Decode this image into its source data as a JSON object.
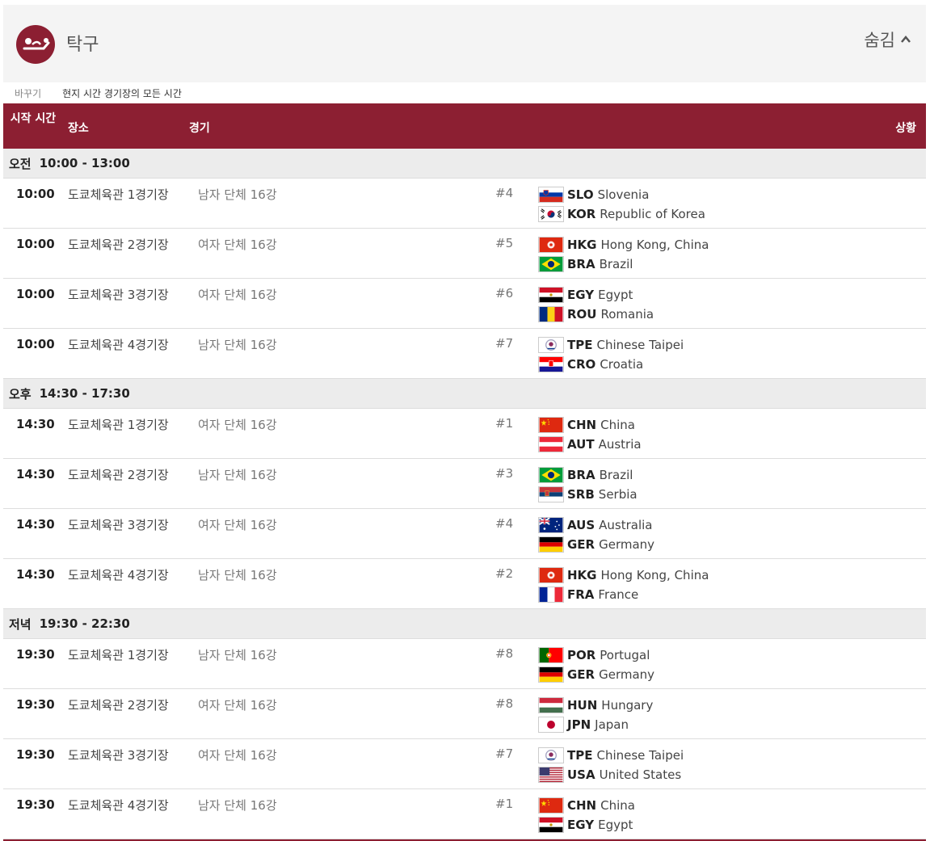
{
  "sport": {
    "icon": "table-tennis-icon",
    "title": "탁구",
    "hide_label": "숨김"
  },
  "time_bar": {
    "switch_label": "바꾸기",
    "timezone_label": "현지 시간 경기장의 모든 시간"
  },
  "table_header": {
    "time": "시작 시간",
    "venue": "장소",
    "event": "경기",
    "status": "상황"
  },
  "colors": {
    "accent": "#8c1f32",
    "session_bg": "#ececec"
  },
  "sessions": [
    {
      "label": "오전",
      "range": "10:00 - 13:00",
      "matches": [
        {
          "time": "10:00",
          "venue": "도쿄체육관 1경기장",
          "event": "남자 단체 16강",
          "match_no": "#4",
          "team1": {
            "code": "SLO",
            "name": "Slovenia",
            "flag": "slo"
          },
          "team2": {
            "code": "KOR",
            "name": "Republic of Korea",
            "flag": "kor"
          }
        },
        {
          "time": "10:00",
          "venue": "도쿄체육관 2경기장",
          "event": "여자 단체 16강",
          "match_no": "#5",
          "team1": {
            "code": "HKG",
            "name": "Hong Kong, China",
            "flag": "hkg"
          },
          "team2": {
            "code": "BRA",
            "name": "Brazil",
            "flag": "bra"
          }
        },
        {
          "time": "10:00",
          "venue": "도쿄체육관 3경기장",
          "event": "여자 단체 16강",
          "match_no": "#6",
          "team1": {
            "code": "EGY",
            "name": "Egypt",
            "flag": "egy"
          },
          "team2": {
            "code": "ROU",
            "name": "Romania",
            "flag": "rou"
          }
        },
        {
          "time": "10:00",
          "venue": "도쿄체육관 4경기장",
          "event": "남자 단체 16강",
          "match_no": "#7",
          "team1": {
            "code": "TPE",
            "name": "Chinese Taipei",
            "flag": "tpe"
          },
          "team2": {
            "code": "CRO",
            "name": "Croatia",
            "flag": "cro"
          }
        }
      ]
    },
    {
      "label": "오후",
      "range": "14:30 - 17:30",
      "matches": [
        {
          "time": "14:30",
          "venue": "도쿄체육관 1경기장",
          "event": "여자 단체 16강",
          "match_no": "#1",
          "team1": {
            "code": "CHN",
            "name": "China",
            "flag": "chn"
          },
          "team2": {
            "code": "AUT",
            "name": "Austria",
            "flag": "aut"
          }
        },
        {
          "time": "14:30",
          "venue": "도쿄체육관 2경기장",
          "event": "남자 단체 16강",
          "match_no": "#3",
          "team1": {
            "code": "BRA",
            "name": "Brazil",
            "flag": "bra"
          },
          "team2": {
            "code": "SRB",
            "name": "Serbia",
            "flag": "srb"
          }
        },
        {
          "time": "14:30",
          "venue": "도쿄체육관 3경기장",
          "event": "여자 단체 16강",
          "match_no": "#4",
          "team1": {
            "code": "AUS",
            "name": "Australia",
            "flag": "aus"
          },
          "team2": {
            "code": "GER",
            "name": "Germany",
            "flag": "ger"
          }
        },
        {
          "time": "14:30",
          "venue": "도쿄체육관 4경기장",
          "event": "남자 단체 16강",
          "match_no": "#2",
          "team1": {
            "code": "HKG",
            "name": "Hong Kong, China",
            "flag": "hkg"
          },
          "team2": {
            "code": "FRA",
            "name": "France",
            "flag": "fra"
          }
        }
      ]
    },
    {
      "label": "저녁",
      "range": "19:30 - 22:30",
      "matches": [
        {
          "time": "19:30",
          "venue": "도쿄체육관 1경기장",
          "event": "남자 단체 16강",
          "match_no": "#8",
          "team1": {
            "code": "POR",
            "name": "Portugal",
            "flag": "por"
          },
          "team2": {
            "code": "GER",
            "name": "Germany",
            "flag": "ger"
          }
        },
        {
          "time": "19:30",
          "venue": "도쿄체육관 2경기장",
          "event": "여자 단체 16강",
          "match_no": "#8",
          "team1": {
            "code": "HUN",
            "name": "Hungary",
            "flag": "hun"
          },
          "team2": {
            "code": "JPN",
            "name": "Japan",
            "flag": "jpn"
          }
        },
        {
          "time": "19:30",
          "venue": "도쿄체육관 3경기장",
          "event": "여자 단체 16강",
          "match_no": "#7",
          "team1": {
            "code": "TPE",
            "name": "Chinese Taipei",
            "flag": "tpe"
          },
          "team2": {
            "code": "USA",
            "name": "United States",
            "flag": "usa"
          }
        },
        {
          "time": "19:30",
          "venue": "도쿄체육관 4경기장",
          "event": "남자 단체 16강",
          "match_no": "#1",
          "team1": {
            "code": "CHN",
            "name": "China",
            "flag": "chn"
          },
          "team2": {
            "code": "EGY",
            "name": "Egypt",
            "flag": "egy"
          }
        }
      ]
    }
  ]
}
